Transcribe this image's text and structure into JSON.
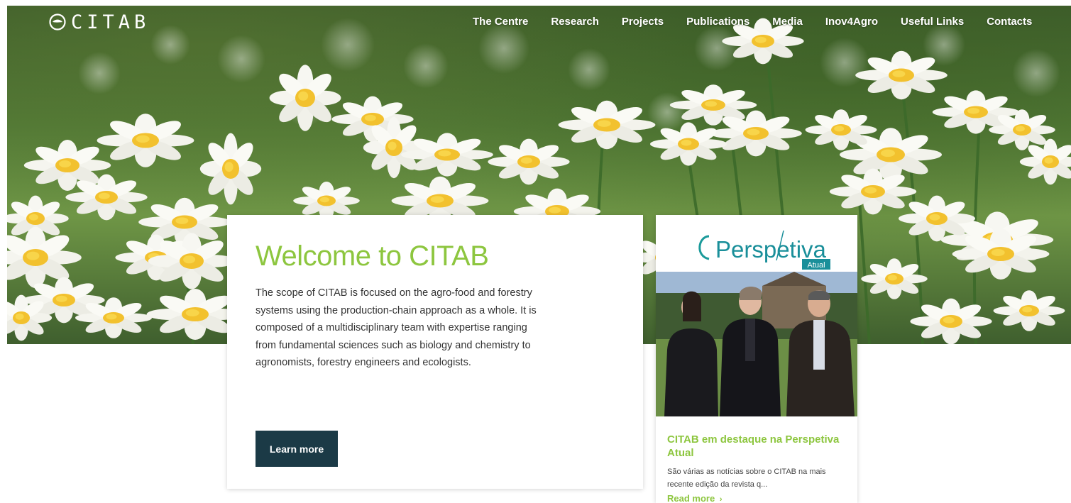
{
  "brand": {
    "logo_text": "CITAB"
  },
  "nav": {
    "items": [
      "The Centre",
      "Research",
      "Projects",
      "Publications",
      "Media",
      "Inov4Agro",
      "Useful Links",
      "Contacts"
    ]
  },
  "welcome": {
    "title": "Welcome to CITAB",
    "body": "The scope of CITAB is focused on the agro-food and forestry systems using the production-chain approach as a whole. It is composed of a multidisciplinary team with expertise ranging from fundamental sciences such as biology and chemistry to agronomists, forestry engineers and ecologists.",
    "button_label": "Learn more"
  },
  "news": {
    "banner_logo": "Perspetiva",
    "banner_sub": "Atual",
    "title": "CITAB em destaque na Perspetiva Atual",
    "excerpt": "São várias as notícias sobre o CITAB na mais recente edição da revista q...",
    "read_more": "Read more"
  },
  "colors": {
    "accent_green": "#8dc63f",
    "button_dark": "#1b3a46",
    "nav_text": "#ffffff"
  },
  "icons": {
    "logo": "leaf-circle-icon",
    "read_more_arrow": "chevron-right-icon"
  }
}
